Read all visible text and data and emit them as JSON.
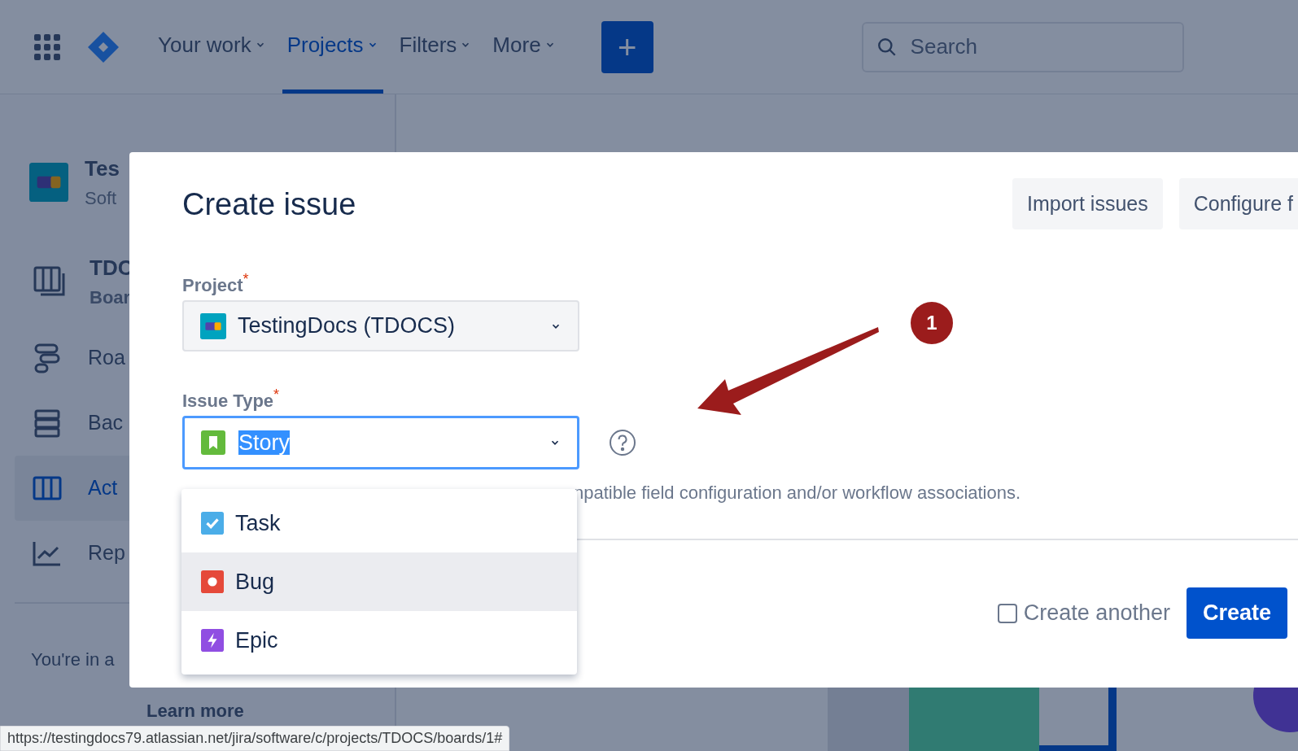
{
  "nav": {
    "items": [
      {
        "label": "Your work",
        "selected": false
      },
      {
        "label": "Projects",
        "selected": true
      },
      {
        "label": "Filters",
        "selected": false
      },
      {
        "label": "More",
        "selected": false
      }
    ],
    "create_symbol": "+",
    "search": {
      "placeholder": "Search"
    }
  },
  "sidebar": {
    "project": {
      "name": "Tes",
      "type": "Soft"
    },
    "board": {
      "name": "TDC",
      "type": "Boar"
    },
    "items": [
      {
        "kind": "roadmap",
        "label": "Roa",
        "selected": false
      },
      {
        "kind": "backlog",
        "label": "Bac",
        "selected": false
      },
      {
        "kind": "board",
        "label": "Act",
        "selected": true
      },
      {
        "kind": "reports",
        "label": "Rep",
        "selected": false
      }
    ],
    "note": "You're in a",
    "link": "Learn more"
  },
  "modal": {
    "title": "Create issue",
    "header_buttons": [
      "Import issues",
      "Configure f"
    ],
    "project": {
      "label": "Project",
      "required_mark": "*",
      "value": "TestingDocs (TDOCS)"
    },
    "issue_type": {
      "label": "Issue Type",
      "required_mark": "*",
      "value": "Story",
      "focused": true
    },
    "options": [
      {
        "kind": "task",
        "label": "Task",
        "selected": false
      },
      {
        "kind": "bug",
        "label": "Bug",
        "selected": true
      },
      {
        "kind": "epic",
        "label": "Epic",
        "selected": false
      }
    ],
    "hint": "npatible field configuration and/or workflow associations.",
    "create_another": {
      "label": "Create another",
      "checked": false
    },
    "submit": "Create"
  },
  "annotation": {
    "badge": "1"
  },
  "status_url": "https://testingdocs79.atlassian.net/jira/software/c/projects/TDOCS/boards/1#"
}
